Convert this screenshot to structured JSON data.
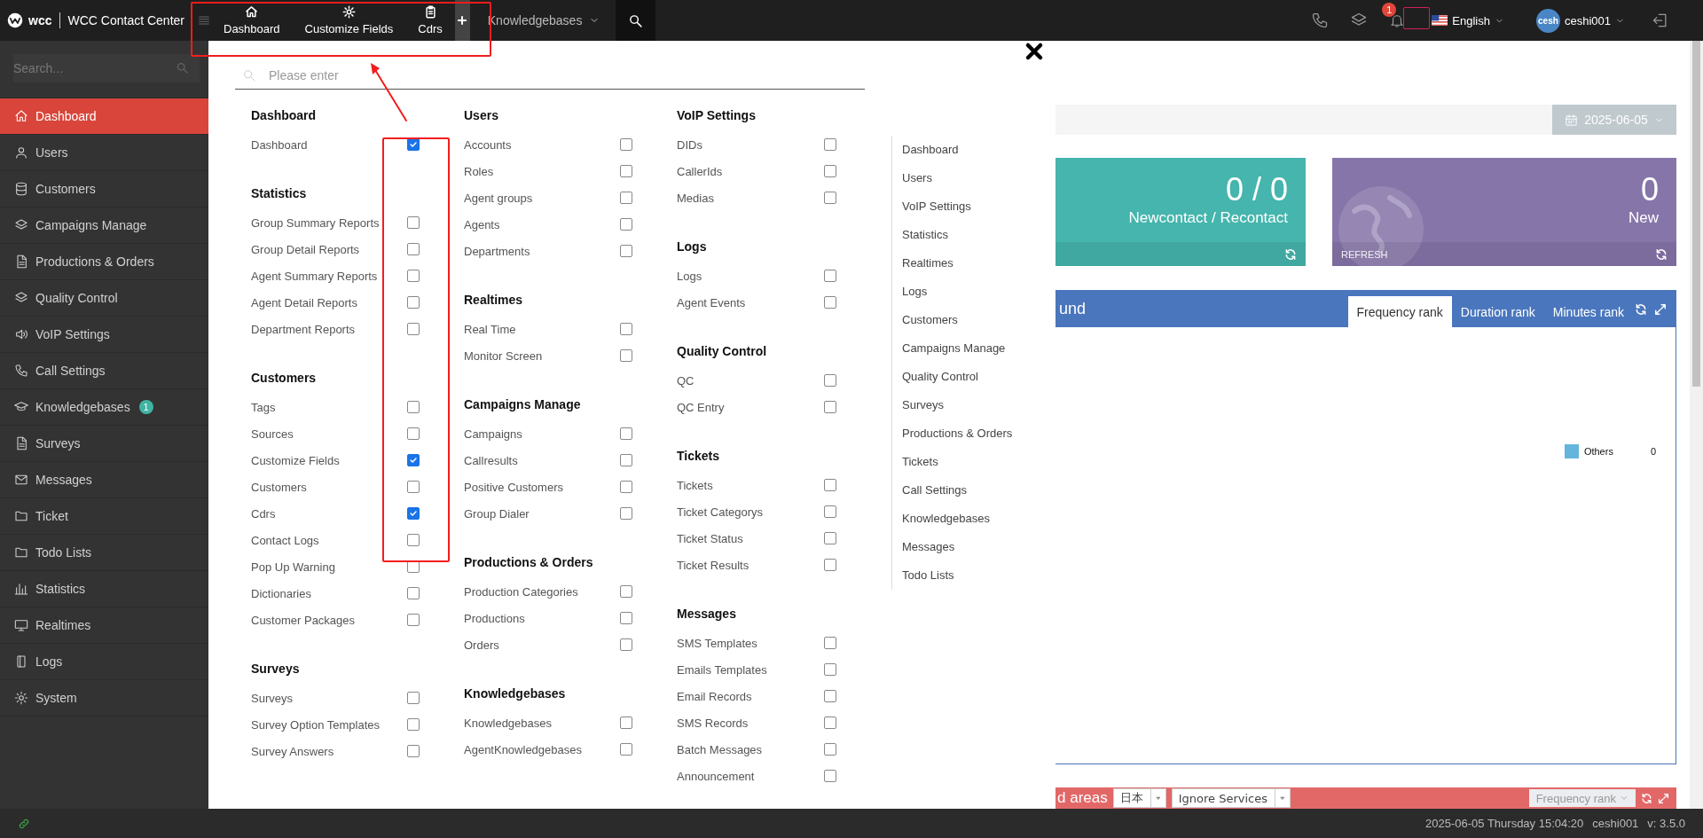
{
  "topbar": {
    "logo_text": "wcc",
    "title": "WCC Contact Center",
    "pinned_tabs": [
      {
        "label": "Dashboard"
      },
      {
        "label": "Customize Fields"
      },
      {
        "label": "Cdrs"
      }
    ],
    "module_dropdown": "Knowledgebases",
    "notification_count": "1",
    "language": "English",
    "avatar_text": "cesh",
    "username": "ceshi001"
  },
  "sidebar": {
    "search_placeholder": "Search...",
    "items": [
      {
        "label": "Dashboard",
        "selected": true
      },
      {
        "label": "Users",
        "selected": false
      },
      {
        "label": "Customers",
        "selected": false
      },
      {
        "label": "Campaigns Manage",
        "selected": false
      },
      {
        "label": "Productions & Orders",
        "selected": false
      },
      {
        "label": "Quality Control",
        "selected": false
      },
      {
        "label": "VoIP Settings",
        "selected": false
      },
      {
        "label": "Call Settings",
        "selected": false
      },
      {
        "label": "Knowledgebases",
        "selected": false,
        "badge": "1"
      },
      {
        "label": "Surveys",
        "selected": false
      },
      {
        "label": "Messages",
        "selected": false
      },
      {
        "label": "Ticket",
        "selected": false
      },
      {
        "label": "Todo Lists",
        "selected": false
      },
      {
        "label": "Statistics",
        "selected": false
      },
      {
        "label": "Realtimes",
        "selected": false
      },
      {
        "label": "Logs",
        "selected": false
      },
      {
        "label": "System",
        "selected": false
      }
    ]
  },
  "customize_dialog": {
    "search_placeholder": "Please enter",
    "columns": [
      {
        "sections": [
          {
            "title": "Dashboard",
            "items": [
              {
                "label": "Dashboard",
                "checked": true
              }
            ]
          },
          {
            "title": "Statistics",
            "items": [
              {
                "label": "Group Summary Reports",
                "checked": false
              },
              {
                "label": "Group Detail Reports",
                "checked": false
              },
              {
                "label": "Agent Summary Reports",
                "checked": false
              },
              {
                "label": "Agent Detail Reports",
                "checked": false
              },
              {
                "label": "Department Reports",
                "checked": false
              }
            ]
          },
          {
            "title": "Customers",
            "items": [
              {
                "label": "Tags",
                "checked": false
              },
              {
                "label": "Sources",
                "checked": false
              },
              {
                "label": "Customize Fields",
                "checked": true
              },
              {
                "label": "Customers",
                "checked": false
              },
              {
                "label": "Cdrs",
                "checked": true
              },
              {
                "label": "Contact Logs",
                "checked": false
              },
              {
                "label": "Pop Up Warning",
                "checked": false
              },
              {
                "label": "Dictionaries",
                "checked": false
              },
              {
                "label": "Customer Packages",
                "checked": false
              }
            ]
          },
          {
            "title": "Surveys",
            "items": [
              {
                "label": "Surveys",
                "checked": false
              },
              {
                "label": "Survey Option Templates",
                "checked": false
              },
              {
                "label": "Survey Answers",
                "checked": false
              }
            ]
          }
        ]
      },
      {
        "sections": [
          {
            "title": "Users",
            "items": [
              {
                "label": "Accounts",
                "checked": false
              },
              {
                "label": "Roles",
                "checked": false
              },
              {
                "label": "Agent groups",
                "checked": false
              },
              {
                "label": "Agents",
                "checked": false
              },
              {
                "label": "Departments",
                "checked": false
              }
            ]
          },
          {
            "title": "Realtimes",
            "items": [
              {
                "label": "Real Time",
                "checked": false
              },
              {
                "label": "Monitor Screen",
                "checked": false
              }
            ]
          },
          {
            "title": "Campaigns Manage",
            "items": [
              {
                "label": "Campaigns",
                "checked": false
              },
              {
                "label": "Callresults",
                "checked": false
              },
              {
                "label": "Positive Customers",
                "checked": false
              },
              {
                "label": "Group Dialer",
                "checked": false
              }
            ]
          },
          {
            "title": "Productions & Orders",
            "items": [
              {
                "label": "Production Categories",
                "checked": false
              },
              {
                "label": "Productions",
                "checked": false
              },
              {
                "label": "Orders",
                "checked": false
              }
            ]
          },
          {
            "title": "Knowledgebases",
            "items": [
              {
                "label": "Knowledgebases",
                "checked": false
              },
              {
                "label": "AgentKnowledgebases",
                "checked": false
              }
            ]
          }
        ]
      },
      {
        "sections": [
          {
            "title": "VoIP Settings",
            "items": [
              {
                "label": "DIDs",
                "checked": false
              },
              {
                "label": "CallerIds",
                "checked": false
              },
              {
                "label": "Medias",
                "checked": false
              }
            ]
          },
          {
            "title": "Logs",
            "items": [
              {
                "label": "Logs",
                "checked": false
              },
              {
                "label": "Agent Events",
                "checked": false
              }
            ]
          },
          {
            "title": "Quality Control",
            "items": [
              {
                "label": "QC",
                "checked": false
              },
              {
                "label": "QC Entry",
                "checked": false
              }
            ]
          },
          {
            "title": "Tickets",
            "items": [
              {
                "label": "Tickets",
                "checked": false
              },
              {
                "label": "Ticket Categorys",
                "checked": false
              },
              {
                "label": "Ticket Status",
                "checked": false
              },
              {
                "label": "Ticket Results",
                "checked": false
              }
            ]
          },
          {
            "title": "Messages",
            "items": [
              {
                "label": "SMS Templates",
                "checked": false
              },
              {
                "label": "Emails Templates",
                "checked": false
              },
              {
                "label": "Email Records",
                "checked": false
              },
              {
                "label": "SMS Records",
                "checked": false
              },
              {
                "label": "Batch Messages",
                "checked": false
              },
              {
                "label": "Announcement",
                "checked": false
              }
            ]
          }
        ]
      }
    ],
    "index": [
      "Dashboard",
      "Users",
      "VoIP Settings",
      "Statistics",
      "Realtimes",
      "Logs",
      "Customers",
      "Campaigns Manage",
      "Quality Control",
      "Surveys",
      "Productions & Orders",
      "Tickets",
      "Call Settings",
      "Knowledgebases",
      "Messages",
      "Todo Lists"
    ]
  },
  "dashboard": {
    "date": "2025-06-05",
    "cards": [
      {
        "value": "0 / 0",
        "label": "Newcontact / Recontact",
        "color": "#45b5ad"
      },
      {
        "value": "0",
        "label": "New",
        "footer": "REFRESH",
        "color": "#8675a9"
      }
    ],
    "rank_panel": {
      "title": "und",
      "tabs": [
        {
          "label": "Frequency rank",
          "selected": true
        },
        {
          "label": "Duration rank",
          "selected": false
        },
        {
          "label": "Minutes rank",
          "selected": false
        }
      ],
      "legend": [
        {
          "label": "Others",
          "value": "0",
          "color": "#64b5dc"
        }
      ]
    },
    "areas_panel": {
      "title": "d areas",
      "selects": [
        "日本",
        "Ignore Services"
      ],
      "rank_dropdown": "Frequency rank"
    }
  },
  "status_bar": {
    "datetime": "2025-06-05 Thursday 15:04:20",
    "user": "ceshi001",
    "version": "v: 3.5.0"
  }
}
